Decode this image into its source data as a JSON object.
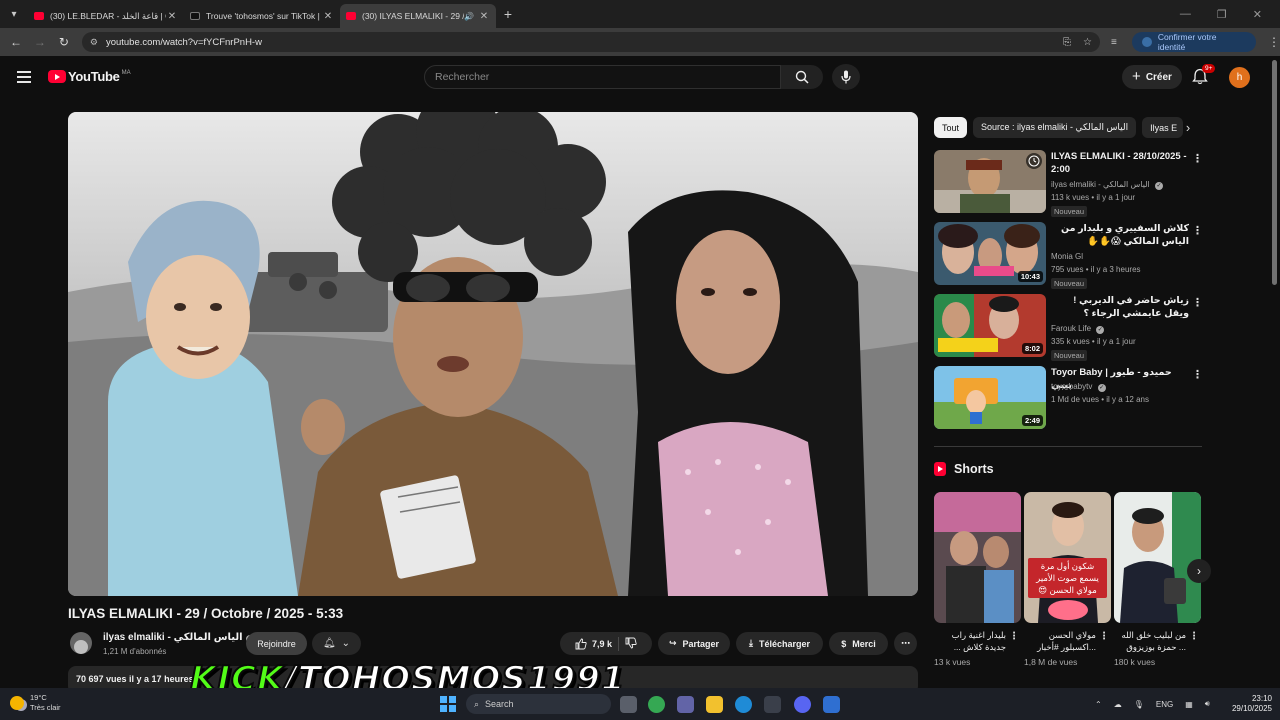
{
  "browser": {
    "tabs": [
      {
        "title": "(30) LE.BLEDAR - قاعة الخلد | Offi",
        "favicon": "youtube",
        "active": false
      },
      {
        "title": "Trouve 'tohosmos' sur TikTok | Re",
        "favicon": "tiktok",
        "active": false
      },
      {
        "title": "(30) ILYAS ELMALIKI - 29 / O",
        "favicon": "youtube",
        "active": true
      }
    ],
    "url": "youtube.com/watch?v=fYCFnrPnH-w",
    "identity_button": "Confirmer votre identité"
  },
  "youtube": {
    "logo_text": "YouTube",
    "country_code": "MA",
    "search_placeholder": "Rechercher",
    "create_label": "Créer",
    "notifications_badge": "9+",
    "avatar_letter": "h"
  },
  "video": {
    "title": "ILYAS ELMALIKI - 29 / Octobre / 2025 - 5:33",
    "channel_name": "ilyas elmaliki - الياس المالكي",
    "subscribers": "1,21 M d'abonnés",
    "join_label": "Rejoindre",
    "likes": "7,9 k",
    "share_label": "Partager",
    "download_label": "Télécharger",
    "thanks_label": "Merci",
    "description_meta": "70 697 vues  il y a 17 heures"
  },
  "filter_chips": [
    "Tout",
    "Source : ilyas elmaliki - الياس المالكي",
    "Ilyas E"
  ],
  "recommendations": [
    {
      "title": "ILYAS ELMALIKI - 28/10/2025 - 2:00",
      "channel": "ilyas elmaliki - الياس المالكي",
      "verified": true,
      "meta": "113 k vues • il y a 1 jour",
      "badge": "Nouveau",
      "duration": "",
      "thumb_color": "#8a7b6a"
    },
    {
      "title": "كلاش السفييري و بليدار من الياس المالكي 😱✋✋",
      "channel": "Monia Gl",
      "verified": false,
      "meta": "795 vues • il y a 3 heures",
      "badge": "Nouveau",
      "duration": "10:43",
      "thumb_color": "#3b5a6e"
    },
    {
      "title": "زياش حاضر في الديربي !ويقل عايمشي الرجاء ؟",
      "channel": "Farouk Life",
      "verified": true,
      "meta": "335 k vues • il y a 1 jour",
      "badge": "Nouveau",
      "duration": "8:02",
      "thumb_color": "#b33a2e"
    },
    {
      "title": "Toyor Baby | حميدو - طيور بيبي",
      "channel": "toyorbabytv",
      "verified": true,
      "meta": "1 Md de vues • il y a 12 ans",
      "badge": "",
      "duration": "2:49",
      "thumb_color": "#6fa84a"
    }
  ],
  "shorts": {
    "heading": "Shorts",
    "items": [
      {
        "title": "بليدار اغنية راب جديدة كلاش ...",
        "views": "13 k vues",
        "thumb_color": "#5a4a4f",
        "overlay": ""
      },
      {
        "title": "مولاي الحسن ...اكسبلور #أخبار",
        "views": "1,8 M de vues",
        "thumb_color": "#c9b9a6",
        "overlay": "شكون أول مرة يسمع صوت الأمير مولاي الحسن 😍"
      },
      {
        "title": "من لبليب خلق الله ... حمزة بوزيزوق",
        "views": "180 k vues",
        "thumb_color": "#6b8a74",
        "overlay": ""
      }
    ]
  },
  "watermark": {
    "kick": "KICK",
    "handle": "/TOHOSMOS1991"
  },
  "taskbar": {
    "temperature": "19°C",
    "weather": "Très clair",
    "search_label": "Search",
    "language": "ENG",
    "time": "23:10",
    "date": "29/10/2025"
  },
  "colors": {
    "youtube_red": "#ff0033",
    "kick_green": "#53fc18",
    "background": "#0f0f0f"
  }
}
